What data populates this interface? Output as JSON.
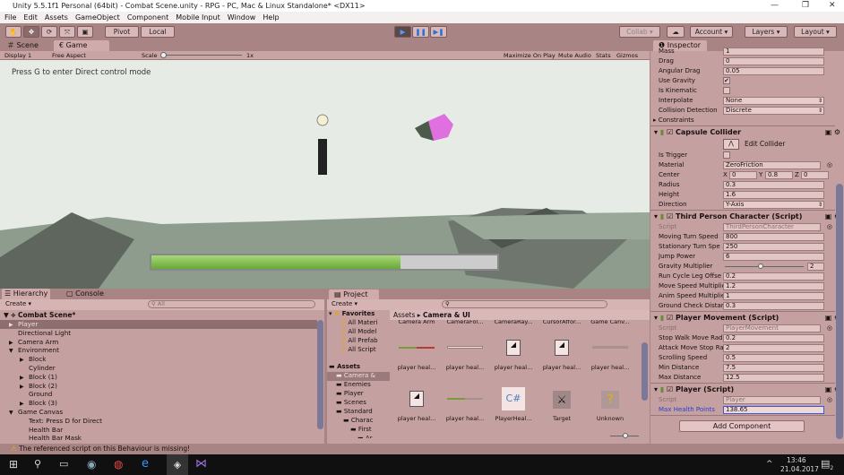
{
  "title": "Unity 5.5.1f1 Personal (64bit) - Combat Scene.unity - RPG - PC, Mac & Linux Standalone* <DX11>",
  "menu": [
    "File",
    "Edit",
    "Assets",
    "GameObject",
    "Component",
    "Mobile Input",
    "Window",
    "Help"
  ],
  "toolbar": {
    "pivot": "Pivot",
    "local": "Local",
    "collab": "Collab ▾",
    "account": "Account",
    "layers": "Layers",
    "layout": "Layout",
    "play_state": "playing"
  },
  "view_tabs": {
    "scene": "Scene",
    "game": "Game"
  },
  "game_toolbar": {
    "display": "Display 1",
    "aspect": "Free Aspect",
    "scale_label": "Scale",
    "scale_value": "1x",
    "maximize": "Maximize On Play",
    "mute": "Mute Audio",
    "stats": "Stats",
    "gizmos": "Gizmos"
  },
  "game_view": {
    "hint": "Press G to enter Direct control mode",
    "health_fraction": 0.72
  },
  "inspector": {
    "tab": "Inspector",
    "rigidbody_rows": [
      {
        "label": "Mass",
        "value": "1"
      },
      {
        "label": "Drag",
        "value": "0"
      },
      {
        "label": "Angular Drag",
        "value": "0.05"
      },
      {
        "label": "Use Gravity",
        "check": true
      },
      {
        "label": "Is Kinematic",
        "check": false
      },
      {
        "label": "Interpolate",
        "value": "None",
        "dropdown": true
      },
      {
        "label": "Collision Detection",
        "value": "Discrete",
        "dropdown": true
      },
      {
        "label": "Constraints",
        "foldout": true
      }
    ],
    "components": [
      {
        "title": "Capsule Collider",
        "edit_collider": "Edit Collider",
        "rows": [
          {
            "label": "Is Trigger",
            "check": false
          },
          {
            "label": "Material",
            "value": "ZeroFriction",
            "object": true
          },
          {
            "label": "Center",
            "xyz": [
              "0",
              "0.8",
              "0"
            ]
          },
          {
            "label": "Radius",
            "value": "0.3"
          },
          {
            "label": "Height",
            "value": "1.6"
          },
          {
            "label": "Direction",
            "value": "Y-Axis",
            "dropdown": true
          }
        ]
      },
      {
        "title": "Third Person Character (Script)",
        "rows": [
          {
            "label": "Script",
            "value": "ThirdPersonCharacter",
            "object": true,
            "disabled": true
          },
          {
            "label": "Moving Turn Speed",
            "value": "800"
          },
          {
            "label": "Stationary Turn Spe",
            "value": "250"
          },
          {
            "label": "Jump Power",
            "value": "6"
          },
          {
            "label": "Gravity Multiplier",
            "slider": 0.44,
            "value": "2"
          },
          {
            "label": "Run Cycle Leg Offse",
            "value": "0.2"
          },
          {
            "label": "Move Speed Multiplie",
            "value": "1.2"
          },
          {
            "label": "Anim Speed Multiplie",
            "value": "1"
          },
          {
            "label": "Ground Check Distar",
            "value": "0.3"
          }
        ]
      },
      {
        "title": "Player Movement (Script)",
        "rows": [
          {
            "label": "Script",
            "value": "PlayerMovement",
            "object": true,
            "disabled": true
          },
          {
            "label": "Stop Walk Move Rad",
            "value": "0.2"
          },
          {
            "label": "Attack Move Stop Ra",
            "value": "2"
          },
          {
            "label": "Scrolling Speed",
            "value": "0.5"
          },
          {
            "label": "Min Distance",
            "value": "7.5"
          },
          {
            "label": "Max Distance",
            "value": "12.5"
          }
        ]
      },
      {
        "title": "Player (Script)",
        "rows": [
          {
            "label": "Script",
            "value": "Player",
            "object": true,
            "disabled": true
          },
          {
            "label": "Max Health Points",
            "value": "138.65",
            "focused": true
          }
        ]
      }
    ],
    "add_component": "Add Component"
  },
  "hierarchy": {
    "tab": "Hierarchy",
    "console_tab": "Console",
    "create": "Create ▾",
    "search_placeholder": "All",
    "scene": "Combat Scene*",
    "items": [
      {
        "name": "Player",
        "depth": 1,
        "fold": "closed",
        "selected": true
      },
      {
        "name": "Directional Light",
        "depth": 1
      },
      {
        "name": "Camera Arm",
        "depth": 1,
        "fold": "closed"
      },
      {
        "name": "Environment",
        "depth": 1,
        "fold": "open"
      },
      {
        "name": "Block",
        "depth": 2,
        "fold": "closed"
      },
      {
        "name": "Cylinder",
        "depth": 2
      },
      {
        "name": "Block (1)",
        "depth": 2,
        "fold": "closed"
      },
      {
        "name": "Block (2)",
        "depth": 2,
        "fold": "closed"
      },
      {
        "name": "Ground",
        "depth": 2
      },
      {
        "name": "Block (3)",
        "depth": 2,
        "fold": "closed"
      },
      {
        "name": "Game Canvas",
        "depth": 1,
        "fold": "open"
      },
      {
        "name": "Text: Press D for Direct",
        "depth": 2
      },
      {
        "name": "Health Bar",
        "depth": 2
      },
      {
        "name": "Health Bar Mask",
        "depth": 2
      }
    ]
  },
  "project": {
    "tab": "Project",
    "create": "Create ▾",
    "breadcrumb": [
      "Assets",
      "Camera & UI"
    ],
    "favorites": {
      "label": "Favorites",
      "items": [
        "All Materi",
        "All Model",
        "All Prefab",
        "All Script"
      ]
    },
    "tree": [
      {
        "name": "Assets",
        "depth": 0,
        "bold": true
      },
      {
        "name": "Camera &",
        "depth": 1,
        "selected": true
      },
      {
        "name": "Enemies",
        "depth": 1
      },
      {
        "name": "Player",
        "depth": 1
      },
      {
        "name": "Scenes",
        "depth": 1
      },
      {
        "name": "Standard",
        "depth": 1
      },
      {
        "name": "Charac",
        "depth": 2
      },
      {
        "name": "First",
        "depth": 3
      },
      {
        "name": "Ar",
        "depth": 4
      }
    ],
    "top_row": [
      "Camera Arm",
      "CameraFol...",
      "CameraRay...",
      "CursorAffor...",
      "Game Canv..."
    ],
    "assets": [
      {
        "name": "player heal...",
        "icon": "bar-red-green"
      },
      {
        "name": "player heal...",
        "icon": "bar-white"
      },
      {
        "name": "player heal...",
        "icon": "image"
      },
      {
        "name": "player heal...",
        "icon": "image"
      },
      {
        "name": "player heal...",
        "icon": "bar-grey"
      },
      {
        "name": "player heal...",
        "icon": "image"
      },
      {
        "name": "player heal...",
        "icon": "bar-green"
      },
      {
        "name": "PlayerHeal...",
        "icon": "csharp"
      },
      {
        "name": "Target",
        "icon": "sword"
      },
      {
        "name": "Unknown",
        "icon": "question"
      }
    ]
  },
  "status": "The referenced script on this Behaviour is missing!",
  "taskbar": {
    "time": "13:46",
    "date": "21.04.2017",
    "notifications": "2"
  }
}
